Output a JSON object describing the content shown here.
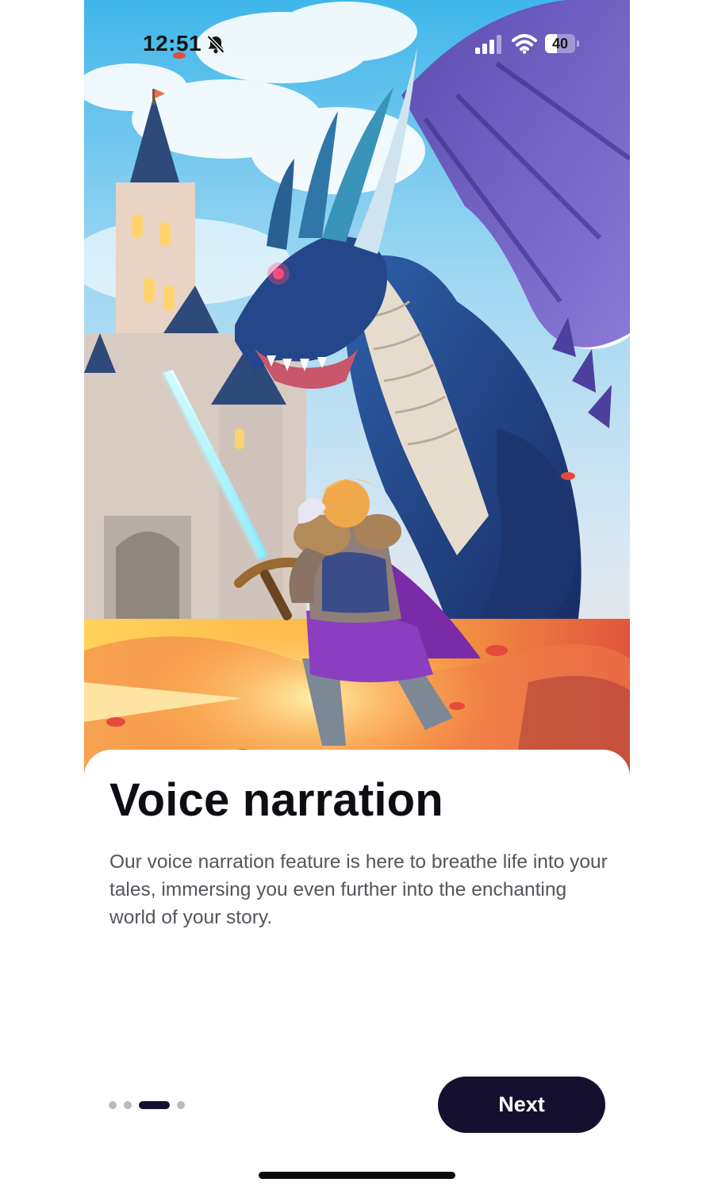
{
  "status_bar": {
    "time": "12:51",
    "battery_level": "40",
    "battery_fraction": 0.4
  },
  "icons": {
    "bell": "bell-off-icon",
    "signal": "cellular-signal-icon",
    "wifi": "wifi-icon",
    "battery": "battery-icon"
  },
  "hero": {
    "illustration": "knight-vs-dragon-illustration"
  },
  "onboarding": {
    "title": "Voice narration",
    "description": "Our voice narration feature is here to breathe life into your tales, immersing you even further into the enchanting world of your story.",
    "page_count": 4,
    "current_page": 3,
    "next_label": "Next"
  },
  "colors": {
    "primary": "#150f30",
    "title_text": "#0d0d14",
    "body_text": "#54545c",
    "dot_inactive": "#b9b9c0",
    "dragon": "#1f3f78",
    "wing": "#4a3f98",
    "cape": "#7a2ca8"
  }
}
